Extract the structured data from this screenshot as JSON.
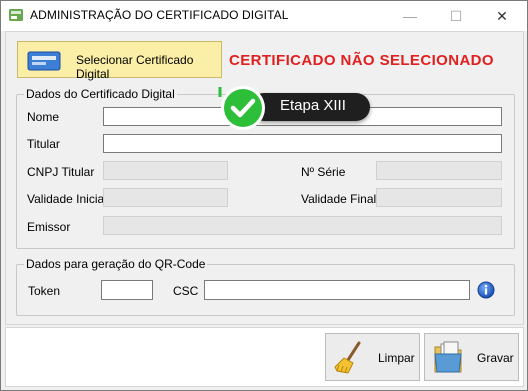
{
  "window": {
    "title": "ADMINISTRAÇÃO DO CERTIFICADO DIGITAL",
    "controls": {
      "minimize": "—",
      "maximize": "☐",
      "close": "✕"
    }
  },
  "toolbar": {
    "select_label": "Selecionar Certificado Digital",
    "status_text": "CERTIFICADO NÃO SELECIONADO"
  },
  "certificate_group": {
    "title": "Dados do Certificado Digital",
    "fields": {
      "nome": {
        "label": "Nome",
        "value": ""
      },
      "titular": {
        "label": "Titular",
        "value": ""
      },
      "cnpj_titular": {
        "label": "CNPJ Titular",
        "value": ""
      },
      "numero_serie": {
        "label": "Nº Série",
        "value": ""
      },
      "validade_inicial": {
        "label": "Validade Inicial",
        "value": ""
      },
      "validade_final": {
        "label": "Validade Final",
        "value": ""
      },
      "emissor": {
        "label": "Emissor",
        "value": ""
      }
    }
  },
  "qrcode_group": {
    "title": "Dados para geração do QR-Code",
    "fields": {
      "token": {
        "label": "Token",
        "value": ""
      },
      "csc": {
        "label": "CSC",
        "value": ""
      }
    }
  },
  "actions": {
    "clear_label": "Limpar",
    "save_label": "Gravar"
  },
  "step_badge": {
    "label": "Etapa XIII"
  },
  "colors": {
    "select_button_bg": "#fbeea6",
    "status_text": "#e02020",
    "badge_green": "#2dbf3a",
    "badge_dark": "#1f1f1f"
  }
}
